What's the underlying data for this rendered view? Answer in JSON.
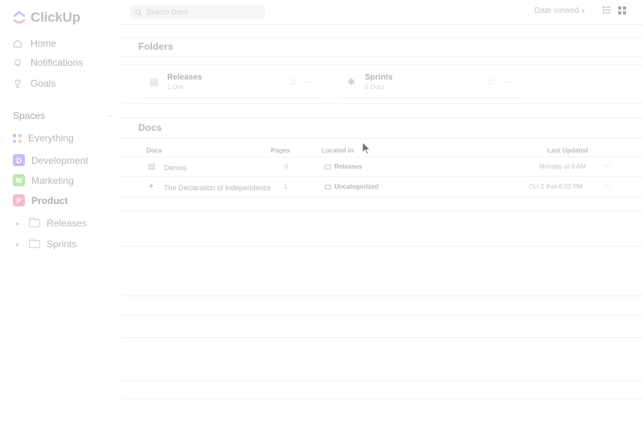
{
  "app": {
    "name": "ClickUp"
  },
  "sidebar": {
    "nav": [
      {
        "label": "Home",
        "icon": "home-icon"
      },
      {
        "label": "Notifications",
        "icon": "bell-icon"
      },
      {
        "label": "Goals",
        "icon": "trophy-icon"
      }
    ],
    "spaces_label": "Spaces",
    "everything_label": "Everything",
    "spaces": [
      {
        "label": "Development",
        "letter": "D",
        "color": "#c9b6f2"
      },
      {
        "label": "Marketing",
        "letter": "M",
        "color": "#b7e4a8"
      },
      {
        "label": "Product",
        "letter": "P",
        "color": "#f3b9d0"
      }
    ],
    "folders": [
      {
        "label": "Releases"
      },
      {
        "label": "Sprints"
      }
    ]
  },
  "topbar": {
    "search_placeholder": "Search Docs",
    "sort_label": "Date viewed"
  },
  "folders_section": {
    "title": "Folders",
    "cards": [
      {
        "name": "Releases",
        "sub": "1 Doc"
      },
      {
        "name": "Sprints",
        "sub": "0 Docs"
      }
    ]
  },
  "docs_section": {
    "title": "Docs",
    "headers": {
      "docs": "Docs",
      "pages": "Pages",
      "located": "Located in",
      "updated": "Last Updated"
    },
    "rows": [
      {
        "name": "Demos",
        "pages": "0",
        "location": "Releases",
        "updated": "Monday at 9 AM"
      },
      {
        "name": "The Declaration of Independence",
        "pages": "1",
        "location": "Uncategorized",
        "updated": "Oct 2 that 6:23 PM"
      }
    ]
  },
  "colors": {
    "accent": "#7b68ee",
    "logo_pink": "#f7a8c8",
    "logo_purple": "#b9a9f4"
  }
}
